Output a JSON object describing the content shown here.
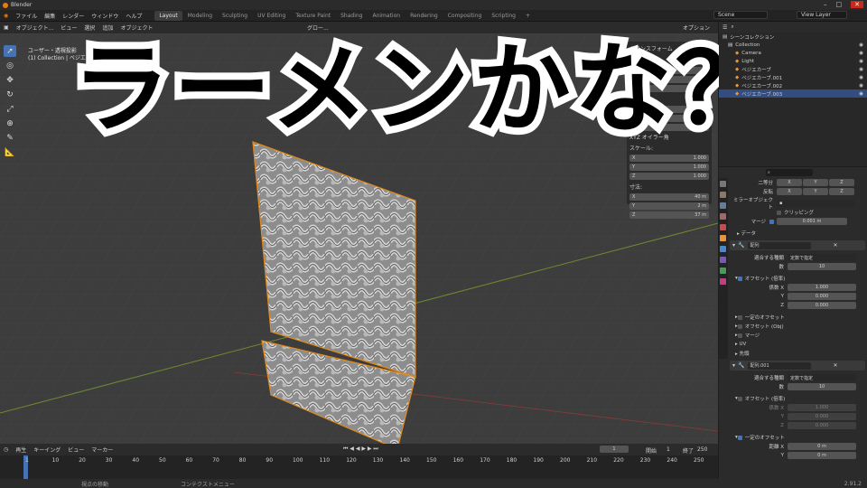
{
  "window": {
    "title": "Blender"
  },
  "menubar": {
    "items": [
      "ファイル",
      "編集",
      "レンダー",
      "ウィンドウ",
      "ヘルプ"
    ],
    "workspaces": [
      "Layout",
      "Modeling",
      "Sculpting",
      "UV Editing",
      "Texture Paint",
      "Shading",
      "Animation",
      "Rendering",
      "Compositing",
      "Scripting"
    ],
    "active_workspace": "Layout",
    "scene": "Scene",
    "view_layer": "View Layer"
  },
  "header3d": {
    "mode": "オブジェクト...",
    "menus": [
      "ビュー",
      "選択",
      "追加",
      "オブジェクト"
    ],
    "transform_orient": "グロー...",
    "options": "オプション"
  },
  "viewport": {
    "view_name": "ユーザー・透視投影",
    "context": "(1) Collection | ベジエカーブ.003",
    "overlay_title": "ラーメンかな？"
  },
  "npanel": {
    "title": "トランスフォーム",
    "location_label": "位置:",
    "rotation_label": "回転:",
    "rotation_mode": "XYZ オイラー角",
    "scale_label": "スケール:",
    "scale": [
      "1.000",
      "1.000",
      "1.000"
    ],
    "dims_label": "寸法:",
    "dims": [
      "40 m",
      "2 m",
      "37 m"
    ],
    "axes": [
      "X",
      "Y",
      "Z"
    ]
  },
  "timeline": {
    "menus": [
      "再生",
      "キーイング",
      "ビュー",
      "マーカー"
    ],
    "current_frame": "1",
    "start_label": "開始",
    "start": "1",
    "end_label": "終了",
    "end": "250",
    "ticks": [
      "1",
      "10",
      "20",
      "30",
      "40",
      "50",
      "60",
      "70",
      "80",
      "90",
      "100",
      "110",
      "120",
      "130",
      "140",
      "150",
      "160",
      "170",
      "180",
      "190",
      "200",
      "210",
      "220",
      "230",
      "240",
      "250"
    ]
  },
  "status": {
    "left": "視点の移動",
    "mid": "コンテクストメニュー",
    "version": "2.91.2"
  },
  "outliner": {
    "title": "シーンコレクション",
    "items": [
      {
        "label": "Collection",
        "indent": 0
      },
      {
        "label": "Camera",
        "indent": 1
      },
      {
        "label": "Light",
        "indent": 1
      },
      {
        "label": "ベジエカーブ",
        "indent": 1
      },
      {
        "label": "ベジエカーブ.001",
        "indent": 1
      },
      {
        "label": "ベジエカーブ.002",
        "indent": 1
      },
      {
        "label": "ベジエカーブ.003",
        "indent": 1,
        "selected": true
      }
    ]
  },
  "props": {
    "bisect_label": "二等分",
    "flip_label": "反転",
    "xyz": [
      "X",
      "Y",
      "Z"
    ],
    "mirror_object_label": "ミラーオブジェクト",
    "clipping_label": "クリッピング",
    "merge_label": "マージ",
    "merge_value": "0.001 m",
    "data_label": "データ",
    "array1": {
      "name": "配列",
      "fit_type_label": "適合する種類",
      "fit_type": "定数で指定",
      "count_label": "数",
      "count": "10",
      "relative_offset_label": "オフセット (倍率)",
      "factor_label": "係数 X",
      "factor": [
        "1.000",
        "0.000",
        "0.000"
      ],
      "const_offset_label": "一定のオフセット",
      "obj_offset_label": "オフセット (Obj)",
      "merge_label": "マージ",
      "uv_label": "UV",
      "caps_label": "先頭"
    },
    "array2": {
      "name": "配列.001",
      "fit_type_label": "適合する種類",
      "fit_type": "定数で指定",
      "count_label": "数",
      "count": "10",
      "relative_offset_label": "オフセット (倍率)",
      "factor_label": "係数 X",
      "factor": [
        "1.000",
        "0.000",
        "0.000"
      ],
      "const_offset_label": "一定のオフセット",
      "distance_label": "距離 X",
      "distance": [
        "0 m",
        "0 m"
      ]
    }
  }
}
